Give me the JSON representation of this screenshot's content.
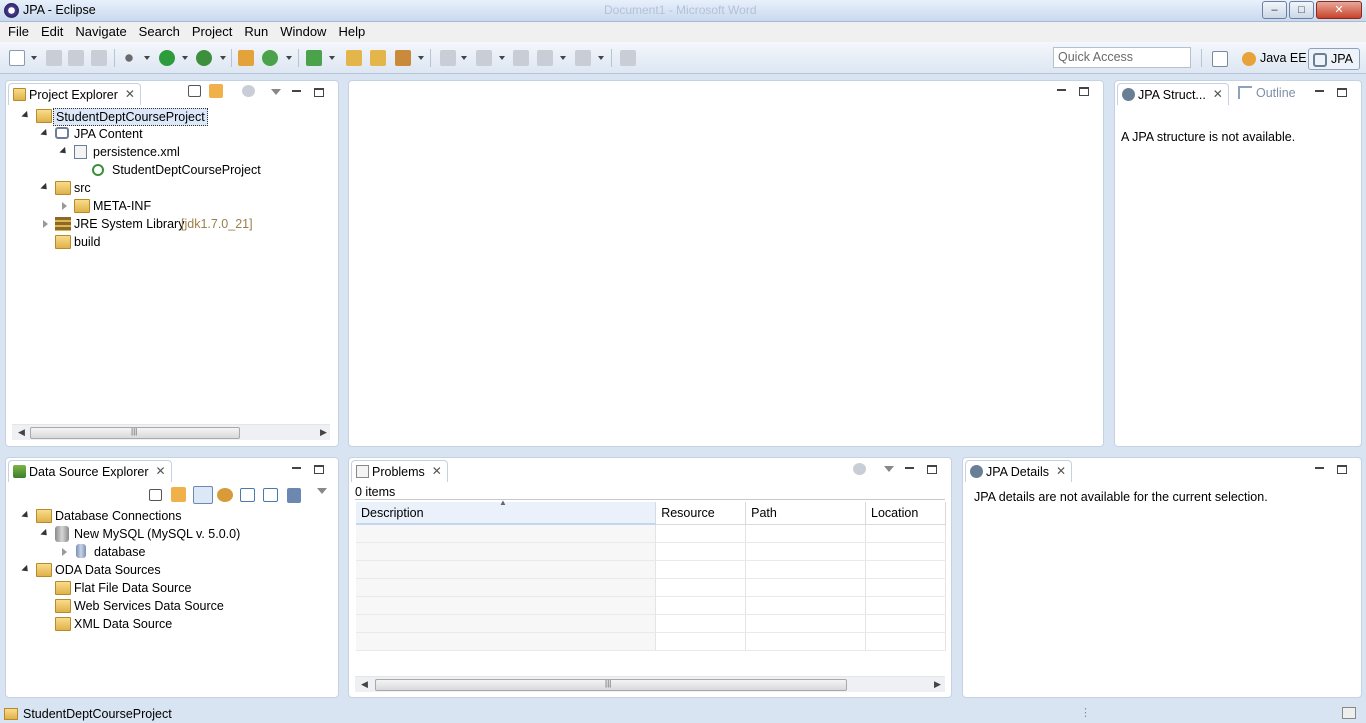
{
  "window": {
    "title": "JPA - Eclipse",
    "background_title": "Document1 - Microsoft Word",
    "minimize_symbol": "–",
    "maximize_symbol": "□",
    "close_symbol": "✕"
  },
  "menu": [
    "File",
    "Edit",
    "Navigate",
    "Search",
    "Project",
    "Run",
    "Window",
    "Help"
  ],
  "toolbar": {
    "quick_access_placeholder": "Quick Access",
    "perspectives": [
      {
        "label": "Java EE",
        "active": false
      },
      {
        "label": "JPA",
        "active": true
      }
    ]
  },
  "project_explorer": {
    "tab_label": "Project Explorer",
    "tree": [
      {
        "label": "StudentDeptCourseProject",
        "selected": true,
        "icon": "project-folder-icon"
      },
      {
        "label": "JPA Content",
        "icon": "jpa-content-icon"
      },
      {
        "label": "persistence.xml",
        "icon": "xml-file-icon"
      },
      {
        "label": "StudentDeptCourseProject",
        "icon": "persistence-unit-icon"
      },
      {
        "label": "src",
        "icon": "source-folder-icon"
      },
      {
        "label": "META-INF",
        "icon": "folder-icon"
      },
      {
        "label": "JRE System Library",
        "suffix": "[jdk1.7.0_21]",
        "icon": "library-icon"
      },
      {
        "label": "build",
        "icon": "folder-icon"
      }
    ]
  },
  "jpa_structure": {
    "tab_label": "JPA Struct...",
    "outline_tab_label": "Outline",
    "message": "A JPA structure is not available."
  },
  "data_source_explorer": {
    "tab_label": "Data Source Explorer",
    "tree": [
      {
        "label": "Database Connections",
        "icon": "folder-icon"
      },
      {
        "label": "New MySQL (MySQL v. 5.0.0)",
        "icon": "database-connection-icon"
      },
      {
        "label": "database",
        "icon": "database-icon"
      },
      {
        "label": "ODA Data Sources",
        "icon": "folder-icon"
      },
      {
        "label": "Flat File Data Source",
        "icon": "folder-icon"
      },
      {
        "label": "Web Services Data Source",
        "icon": "folder-icon"
      },
      {
        "label": "XML Data Source",
        "icon": "folder-icon"
      }
    ]
  },
  "problems": {
    "tab_label": "Problems",
    "count_text": "0 items",
    "columns": [
      "Description",
      "Resource",
      "Path",
      "Location"
    ],
    "empty_rows": 8
  },
  "jpa_details": {
    "tab_label": "JPA Details",
    "message": "JPA details are not available for the current selection."
  },
  "status_bar": {
    "text": "StudentDeptCourseProject"
  },
  "colors": {
    "workbench_bg": "#d9e4f2",
    "panel_border": "#c6d2e3",
    "selection_bg": "#dce8f7"
  }
}
